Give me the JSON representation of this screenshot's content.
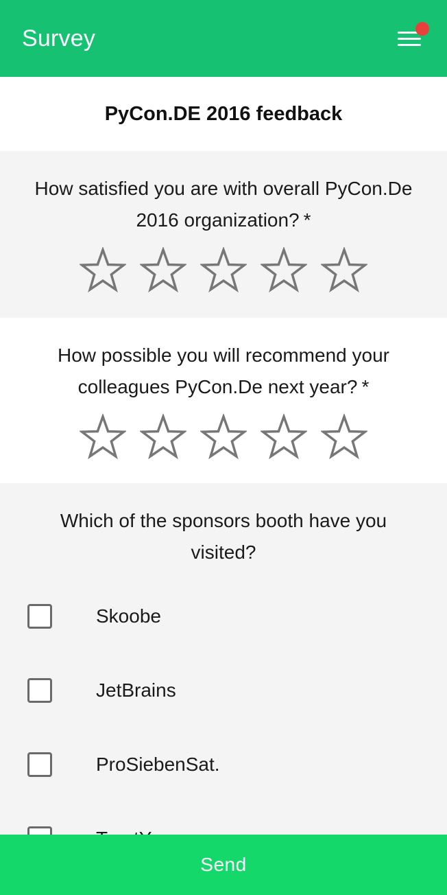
{
  "header": {
    "title": "Survey",
    "menu_icon": "hamburger-menu-icon",
    "notification_color": "#e8413c",
    "color": "#16c172"
  },
  "survey": {
    "title": "PyCon.DE 2016 feedback"
  },
  "questions": [
    {
      "text": "How satisfied you are with overall PyCon.De 2016 organization?",
      "required_mark": "*",
      "type": "rating",
      "max_rating": 5,
      "rating": 0
    },
    {
      "text": "How possible you will recommend your colleagues PyCon.De next year?",
      "required_mark": "*",
      "type": "rating",
      "max_rating": 5,
      "rating": 0
    },
    {
      "text": "Which of the sponsors booth have you visited?",
      "type": "checkbox",
      "options": [
        {
          "label": "Skoobe",
          "checked": false
        },
        {
          "label": "JetBrains",
          "checked": false
        },
        {
          "label": "ProSiebenSat.",
          "checked": false
        },
        {
          "label": "TrustYou",
          "checked": false
        }
      ]
    }
  ],
  "send_button": {
    "label": "Send",
    "color": "#14d86a"
  },
  "icons": {
    "star": "star-outline-icon",
    "checkbox": "checkbox-unchecked-icon"
  }
}
